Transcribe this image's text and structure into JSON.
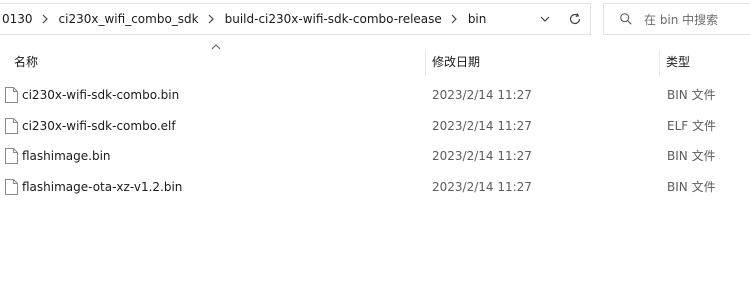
{
  "address_bar": {
    "crumbs": [
      "0130",
      "ci230x_wifi_combo_sdk",
      "build-ci230x-wifi-sdk-combo-release",
      "bin"
    ]
  },
  "search": {
    "placeholder": "在 bin 中搜索"
  },
  "columns": {
    "name": "名称",
    "date": "修改日期",
    "type": "类型"
  },
  "files": [
    {
      "name": "ci230x-wifi-sdk-combo.bin",
      "date": "2023/2/14 11:27",
      "type": "BIN 文件"
    },
    {
      "name": "ci230x-wifi-sdk-combo.elf",
      "date": "2023/2/14 11:27",
      "type": "ELF 文件"
    },
    {
      "name": "flashimage.bin",
      "date": "2023/2/14 11:27",
      "type": "BIN 文件"
    },
    {
      "name": "flashimage-ota-xz-v1.2.bin",
      "date": "2023/2/14 11:27",
      "type": "BIN 文件"
    }
  ]
}
